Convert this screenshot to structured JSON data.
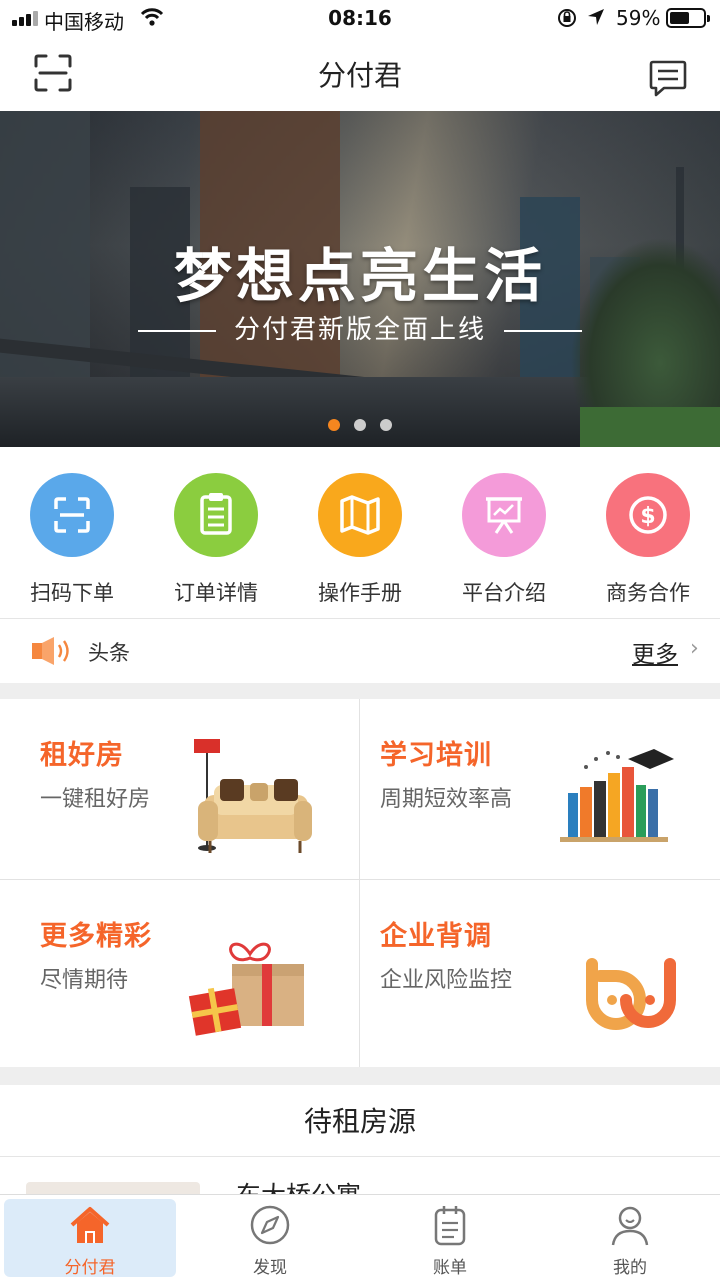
{
  "status_bar": {
    "carrier": "中国移动",
    "time": "08:16",
    "battery_percent": "59%",
    "battery_level": 0.59
  },
  "nav": {
    "title": "分付君",
    "left_icon": "scan-icon",
    "right_icon": "message-icon"
  },
  "banner": {
    "title": "梦想点亮生活",
    "subtitle": "分付君新版全面上线",
    "slide_count": 3,
    "active_slide": 1
  },
  "quick_actions": [
    {
      "label": "扫码下单",
      "icon": "scan-icon",
      "color": "#5aa8ea"
    },
    {
      "label": "订单详情",
      "icon": "clipboard-icon",
      "color": "#8bcd3f"
    },
    {
      "label": "操作手册",
      "icon": "map-icon",
      "color": "#f9a81c"
    },
    {
      "label": "平台介绍",
      "icon": "presentation-icon",
      "color": "#f49bd9"
    },
    {
      "label": "商务合作",
      "icon": "dollar-icon",
      "color": "#f8727d"
    }
  ],
  "headline": {
    "label": "头条",
    "more": "更多",
    "icon": "speaker-icon"
  },
  "features": [
    {
      "title": "租好房",
      "subtitle": "一键租好房",
      "icon": "sofa-icon"
    },
    {
      "title": "学习培训",
      "subtitle": "周期短效率高",
      "icon": "books-icon"
    },
    {
      "title": "更多精彩",
      "subtitle": "尽情期待",
      "icon": "gift-icon"
    },
    {
      "title": "企业背调",
      "subtitle": "企业风险监控",
      "icon": "company-logo-icon"
    }
  ],
  "listings": {
    "title": "待租房源",
    "items": [
      {
        "name": "东大桥公寓"
      }
    ]
  },
  "tabbar": [
    {
      "label": "分付君",
      "icon": "home-icon",
      "active": true
    },
    {
      "label": "发现",
      "icon": "compass-icon",
      "active": false
    },
    {
      "label": "账单",
      "icon": "bill-icon",
      "active": false
    },
    {
      "label": "我的",
      "icon": "user-icon",
      "active": false
    }
  ],
  "colors": {
    "accent": "#f5652a",
    "indicator": "#f5861f",
    "tab_active_bg": "#dcebf9"
  }
}
